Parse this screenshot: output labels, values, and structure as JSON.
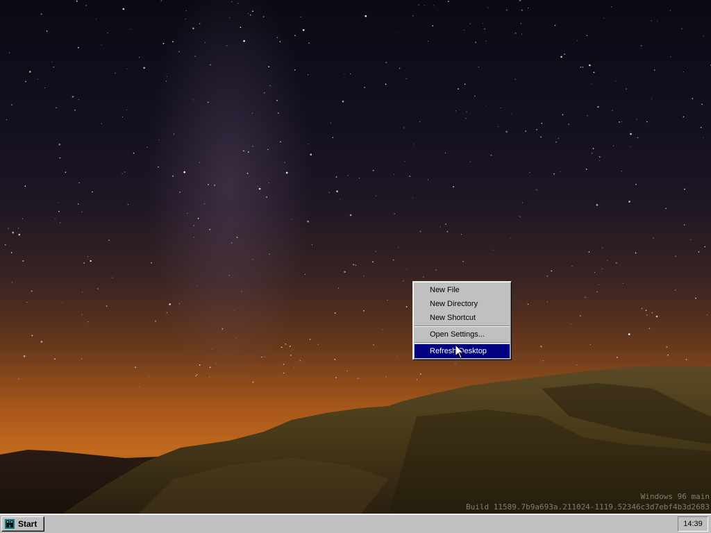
{
  "desktop": {
    "wallpaper": "milky-way-night-sky"
  },
  "watermark": {
    "line1": "Windows 96 main",
    "line2": "Build 11589.7b9a693a.211024-1119.52346c3d7ebf4b3d2683"
  },
  "context_menu": {
    "items": [
      {
        "label": "New File"
      },
      {
        "label": "New Directory"
      },
      {
        "label": "New Shortcut"
      },
      {
        "label": "Open Settings..."
      },
      {
        "label": "Refresh Desktop",
        "highlighted": true
      }
    ],
    "highlight_color": "#000080"
  },
  "taskbar": {
    "start_label": "Start",
    "start_icon": "windows96-logo-icon",
    "clock": "14:39"
  },
  "colors": {
    "taskbar_bg": "#c0c0c0",
    "menu_bg": "#c0c0c0",
    "selection": "#000080"
  }
}
